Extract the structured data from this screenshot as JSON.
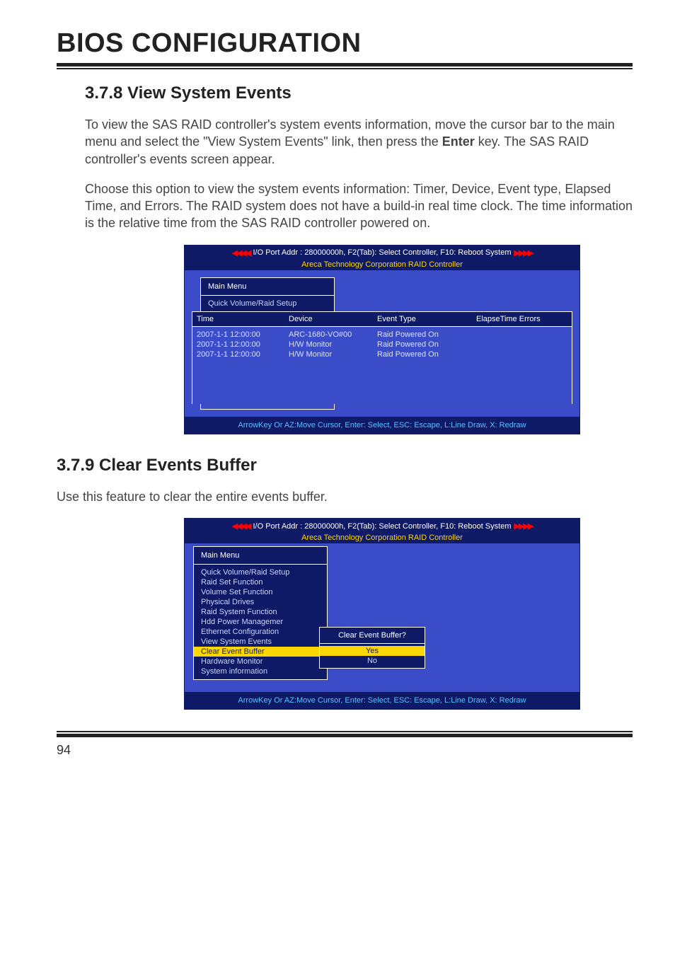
{
  "chapter_title": "BIOS CONFIGURATION",
  "section1": {
    "heading": "3.7.8 View System Events",
    "para1": "To view the SAS RAID controller's system events information, move the cursor bar to the main menu and select the \"View System Events\" link, then press the Enter key. The SAS RAID controller's events screen appear.",
    "para2": "Choose this option to view the system events information: Timer, Device, Event type, Elapsed Time, and Errors. The RAID system does not have a build-in real time clock. The time information is the relative time from the SAS RAID controller powered on.",
    "bold_word": "Enter"
  },
  "bios_common": {
    "top_line": "I/O Port Addr : 28000000h, F2(Tab): Select Controller, F10: Reboot System",
    "sub_line": "Areca Technology Corporation RAID Controller",
    "footer": "ArrowKey Or AZ:Move Cursor, Enter: Select, ESC: Escape, L:Line Draw, X: Redraw"
  },
  "bios1": {
    "menu_title": "Main Menu",
    "menu_visible": "Quick Volume/Raid Setup",
    "columns": {
      "time": "Time",
      "device": "Device",
      "event_type": "Event Type",
      "elapse": "ElapseTime Errors"
    },
    "rows": [
      {
        "time": "2007-1-1  12:00:00",
        "device": "ARC-1680-VO#00",
        "event": "Raid Powered On"
      },
      {
        "time": "2007-1-1  12:00:00",
        "device": "H/W Monitor",
        "event": "Raid Powered On"
      },
      {
        "time": "2007-1-1  12:00:00",
        "device": "H/W Monitor",
        "event": "Raid Powered On"
      }
    ]
  },
  "section2": {
    "heading": "3.7.9 Clear Events Buffer",
    "para1": "Use this feature to clear the entire events buffer."
  },
  "bios2": {
    "menu_title": "Main Menu",
    "menu_items": [
      "Quick Volume/Raid Setup",
      "Raid Set Function",
      "Volume Set Function",
      "Physical Drives",
      "Raid System Function",
      "Hdd Power Managemer",
      "Ethernet Configuration",
      "View System Events",
      "Clear Event Buffer",
      "Hardware Monitor",
      "System information"
    ],
    "selected_index": 8,
    "dialog": {
      "title": "Clear Event Buffer?",
      "yes": "Yes",
      "no": "No"
    }
  },
  "page_number": "94"
}
